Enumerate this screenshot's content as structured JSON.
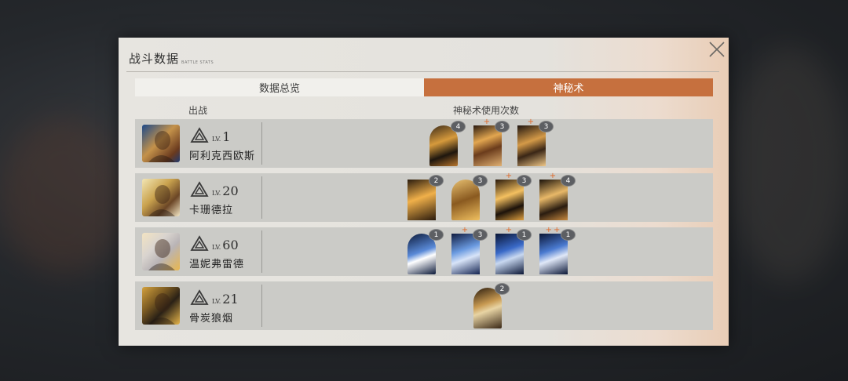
{
  "header": {
    "title": "战斗数据",
    "subtitle": "BATTLE STATS"
  },
  "tabs": [
    {
      "label": "数据总览",
      "active": false
    },
    {
      "label": "神秘术",
      "active": true
    }
  ],
  "columns": {
    "deploy": "出战",
    "usage": "神秘术使用次数"
  },
  "colors": {
    "accent": "#c6703e",
    "row_bg": "#cbcbc7",
    "modal_bg": "#e7e5e0"
  },
  "rows": [
    {
      "name": "阿利克西欧斯",
      "lv_prefix": "LV.",
      "level": "1",
      "avatar_icon": "portrait-warrior-icon",
      "rank_icon": "rank-triangle-icon",
      "cards": [
        {
          "count": "4",
          "pluses": ""
        },
        {
          "count": "3",
          "pluses": "+"
        },
        {
          "count": "3",
          "pluses": "+"
        }
      ]
    },
    {
      "name": "卡珊德拉",
      "lv_prefix": "LV.",
      "level": "20",
      "avatar_icon": "portrait-cassandra-icon",
      "rank_icon": "rank-triangle-icon",
      "cards": [
        {
          "count": "2",
          "pluses": ""
        },
        {
          "count": "3",
          "pluses": ""
        },
        {
          "count": "3",
          "pluses": "+"
        },
        {
          "count": "4",
          "pluses": "+"
        }
      ]
    },
    {
      "name": "温妮弗雷德",
      "lv_prefix": "LV.",
      "level": "60",
      "avatar_icon": "portrait-winifred-icon",
      "rank_icon": "rank-triangle-icon",
      "cards": [
        {
          "count": "1",
          "pluses": ""
        },
        {
          "count": "3",
          "pluses": "+"
        },
        {
          "count": "1",
          "pluses": "+"
        },
        {
          "count": "1",
          "pluses": "++"
        }
      ]
    },
    {
      "name": "骨炭狼烟",
      "lv_prefix": "LV.",
      "level": "21",
      "avatar_icon": "portrait-wolf-icon",
      "rank_icon": "rank-triangle-icon",
      "cards": [
        {
          "count": "2",
          "pluses": ""
        }
      ]
    }
  ]
}
